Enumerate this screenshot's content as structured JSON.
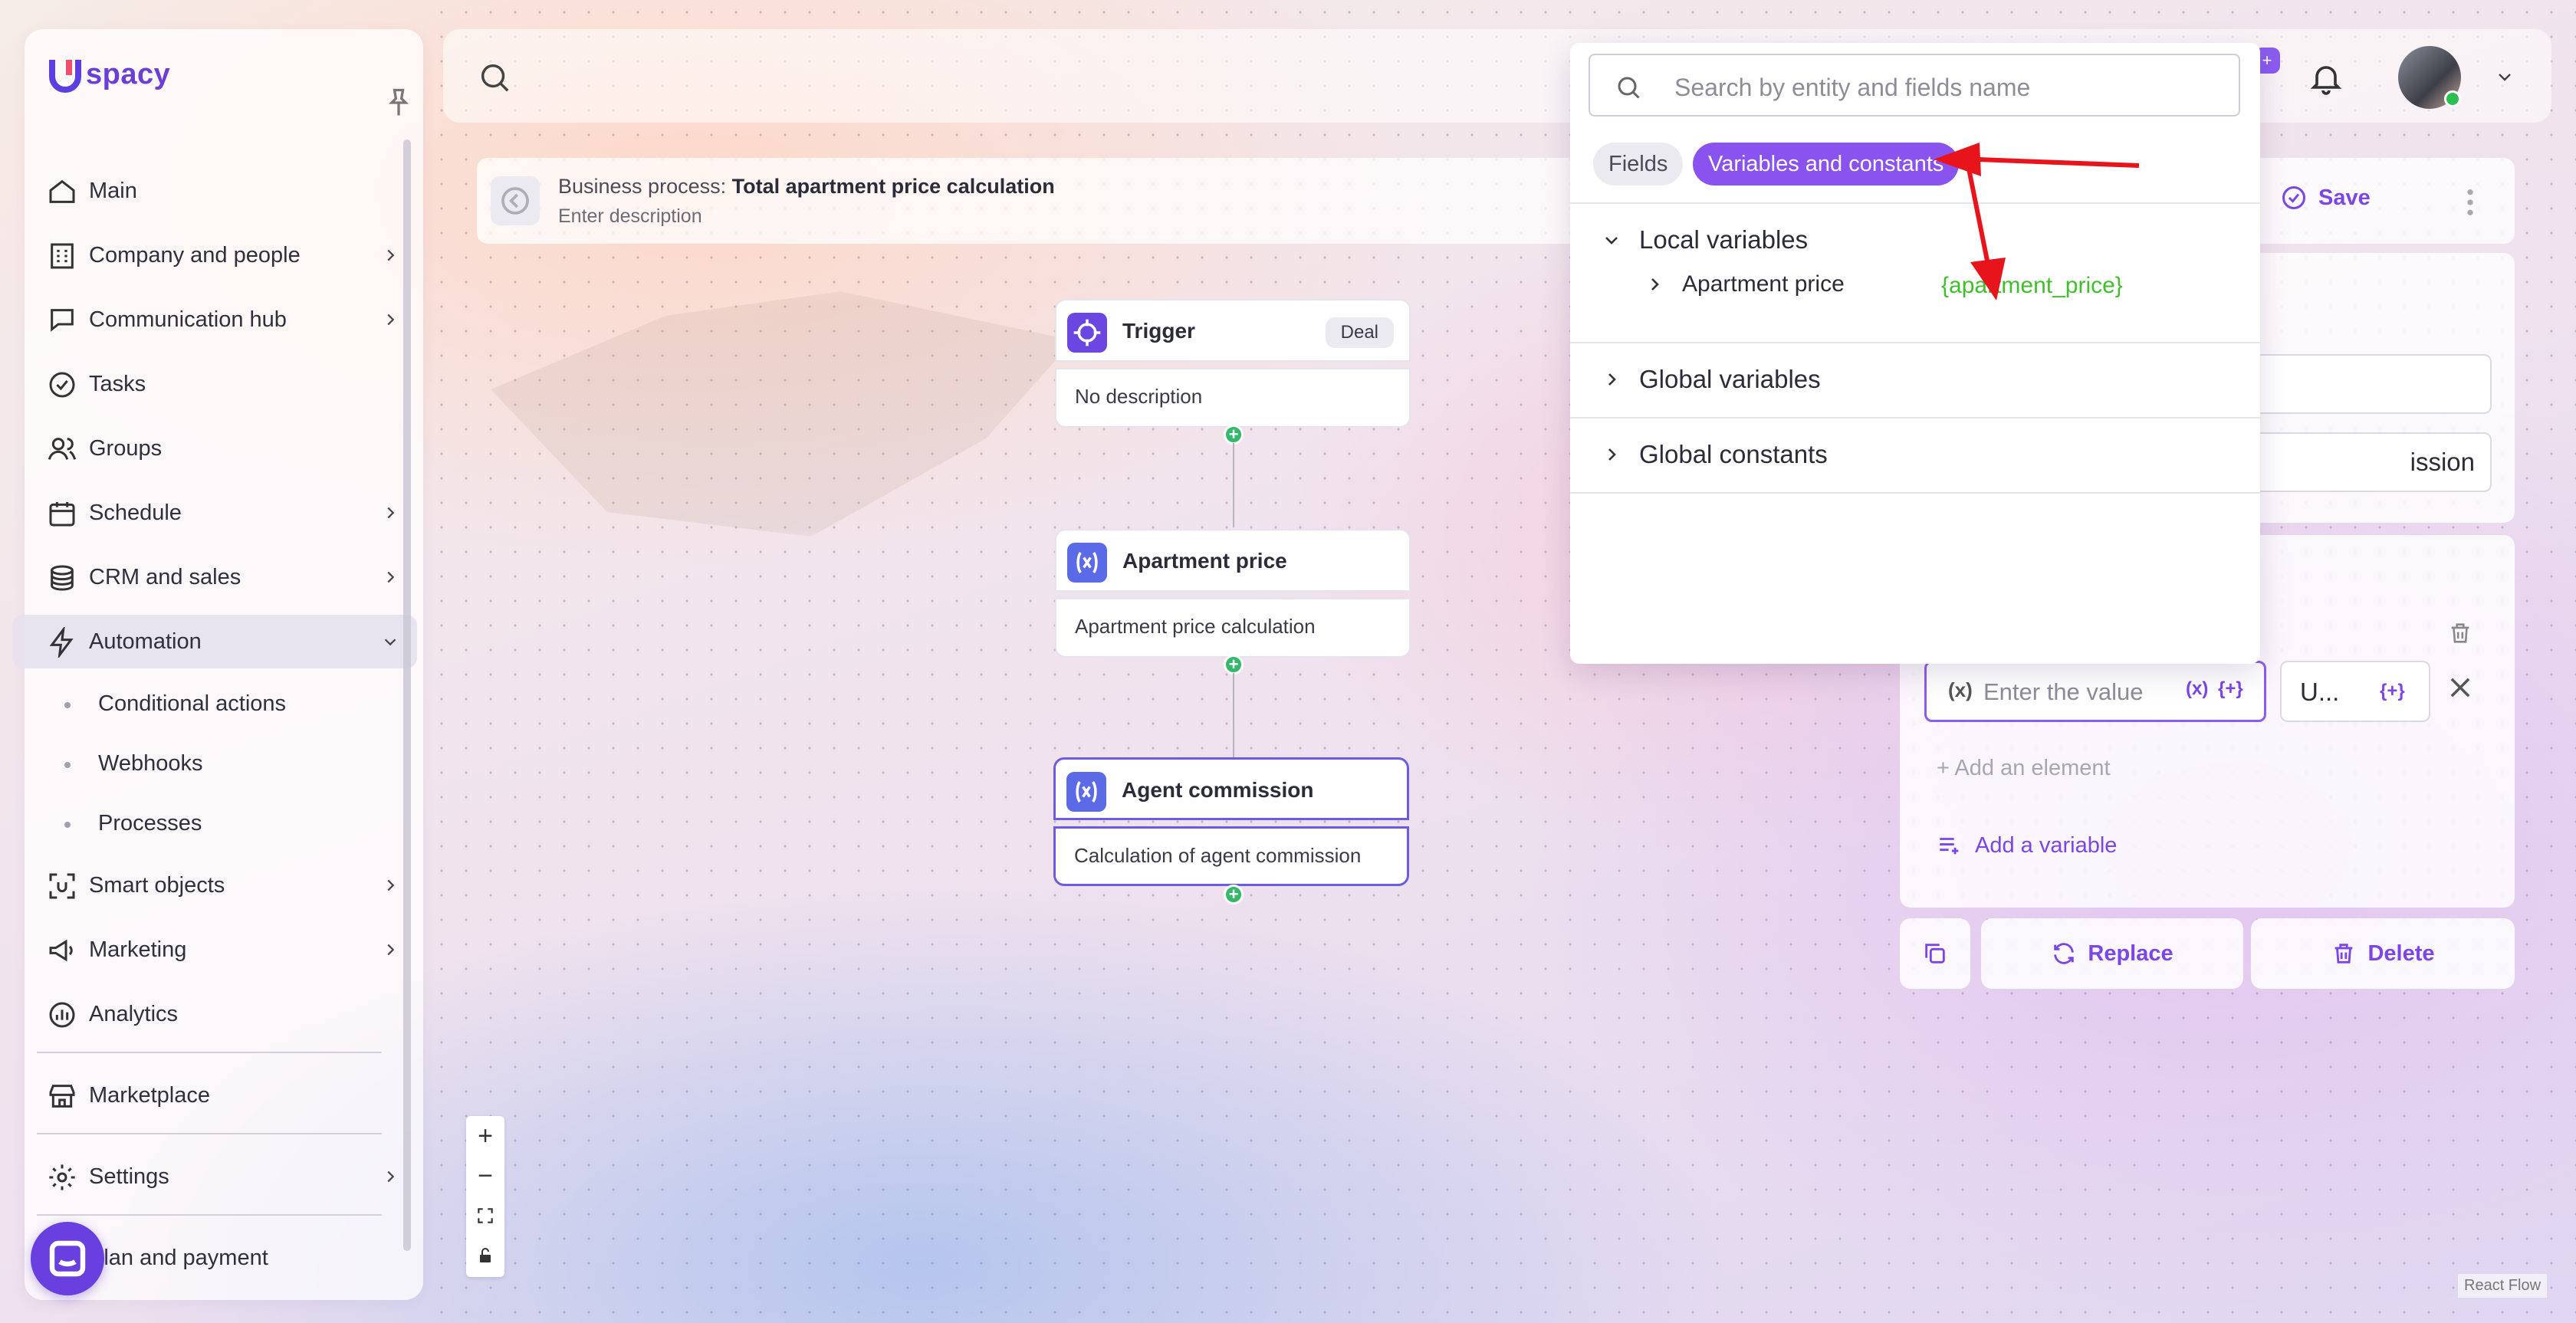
{
  "brand": {
    "name": "spacy"
  },
  "sidebar": {
    "items": [
      {
        "label": "Main"
      },
      {
        "label": "Company and people"
      },
      {
        "label": "Communication hub"
      },
      {
        "label": "Tasks"
      },
      {
        "label": "Groups"
      },
      {
        "label": "Schedule"
      },
      {
        "label": "CRM and sales"
      },
      {
        "label": "Automation"
      }
    ],
    "automation_sub": [
      {
        "label": "Conditional actions"
      },
      {
        "label": "Webhooks"
      },
      {
        "label": "Processes"
      }
    ],
    "items_after": [
      {
        "label": "Smart objects"
      },
      {
        "label": "Marketing"
      },
      {
        "label": "Analytics"
      }
    ],
    "marketplace": "Marketplace",
    "settings": "Settings",
    "plan": "Plan and payment"
  },
  "business_process": {
    "prefix": "Business process:",
    "title": "Total apartment price calculation",
    "description": "Enter description"
  },
  "nodes": {
    "trigger": {
      "title": "Trigger",
      "tag": "Deal",
      "description": "No description"
    },
    "apartment": {
      "title": "Apartment price",
      "description": "Apartment price calculation"
    },
    "agent": {
      "title": "Agent commission",
      "description": "Calculation of agent commission"
    }
  },
  "popover": {
    "search_placeholder": "Search by entity and fields name",
    "tabs": {
      "fields": "Fields",
      "variables": "Variables and constants"
    },
    "groups": {
      "local": "Local variables",
      "global_vars": "Global variables",
      "global_consts": "Global constants"
    },
    "local_items": [
      {
        "label": "Apartment price",
        "key": "{apartment_price}"
      }
    ]
  },
  "right_panel": {
    "save": "Save",
    "field2_partial": "ission",
    "value_placeholder": "Enter the value",
    "var_btn": "(x)",
    "const_btn": "{+}",
    "x_label": "(x)",
    "unit_value": "U...",
    "add_element": "Add an element",
    "add_variable": "Add a variable",
    "replace": "Replace",
    "delete": "Delete"
  },
  "topbar": {
    "badge": "+"
  },
  "footer": {
    "react_flow": "React Flow"
  },
  "colors": {
    "accent": "#7b45e8",
    "green": "#34b96b",
    "key_green": "#3fbf2a",
    "arrow_red": "#e8141c"
  },
  "icons": [
    "search-icon",
    "pin-icon",
    "home-icon",
    "building-icon",
    "chat-icon",
    "check-circle-icon",
    "people-icon",
    "calendar-icon",
    "coins-icon",
    "bolt-icon",
    "scan-icon",
    "megaphone-icon",
    "chart-icon",
    "store-icon",
    "gear-icon",
    "bell-icon",
    "chevron-down-icon",
    "chevron-right-icon",
    "trash-icon",
    "close-icon",
    "plus-icon",
    "copy-icon",
    "refresh-icon",
    "crosshair-icon",
    "variable-icon"
  ]
}
